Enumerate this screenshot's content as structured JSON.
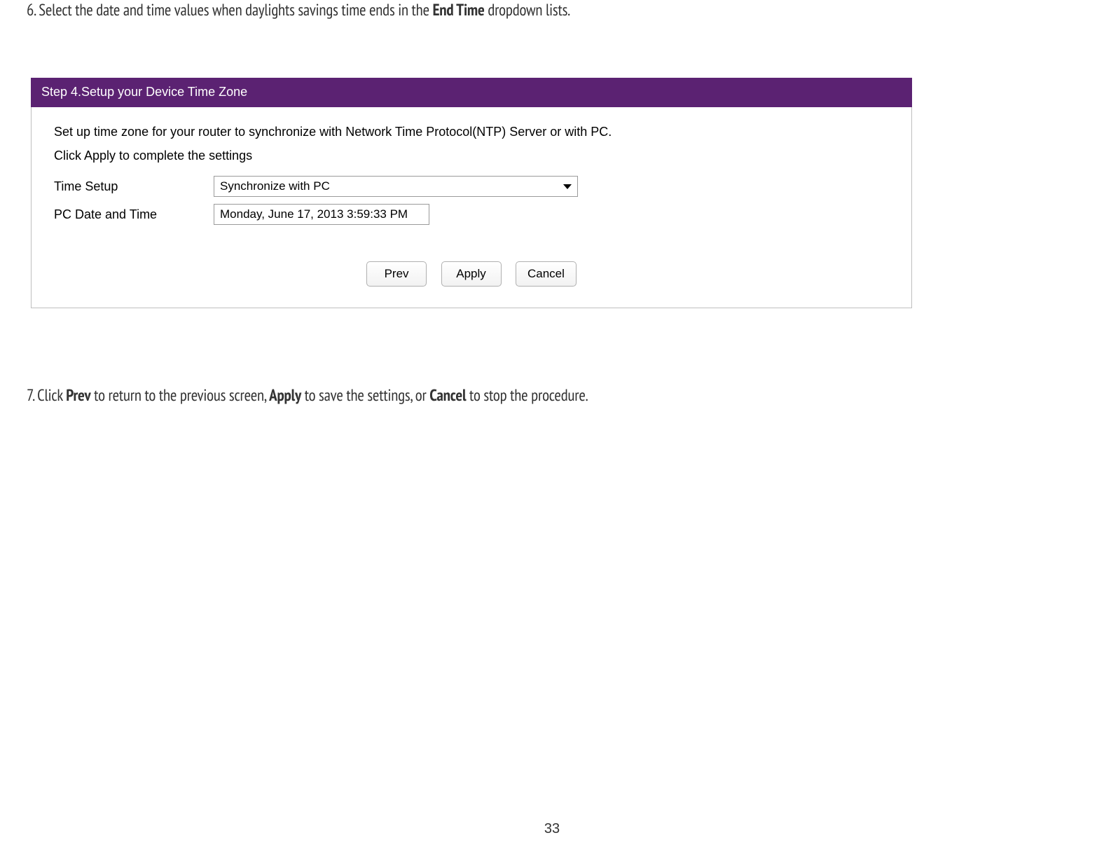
{
  "step6": {
    "prefix": "6. Select the date and time values when daylights savings time ends in the ",
    "bold": "End Time",
    "suffix": " dropdown lists."
  },
  "panel": {
    "header": "Step 4.Setup your Device Time Zone",
    "desc": "Set up time zone for your router to synchronize with Network Time Protocol(NTP) Server or with PC.",
    "sub": "Click Apply to complete the settings",
    "timeSetupLabel": "Time Setup",
    "timeSetupValue": "Synchronize with PC",
    "pcDateLabel": "PC Date and Time",
    "pcDateValue": "Monday, June 17, 2013 3:59:33 PM",
    "buttons": {
      "prev": "Prev",
      "apply": "Apply",
      "cancel": "Cancel"
    }
  },
  "step7": {
    "prefix": "7. Click ",
    "b1": "Prev",
    "mid1": " to return to the previous screen, ",
    "b2": "Apply",
    "mid2": " to save the settings, or ",
    "b3": "Cancel",
    "suffix": " to stop the procedure."
  },
  "pageNumber": "33"
}
